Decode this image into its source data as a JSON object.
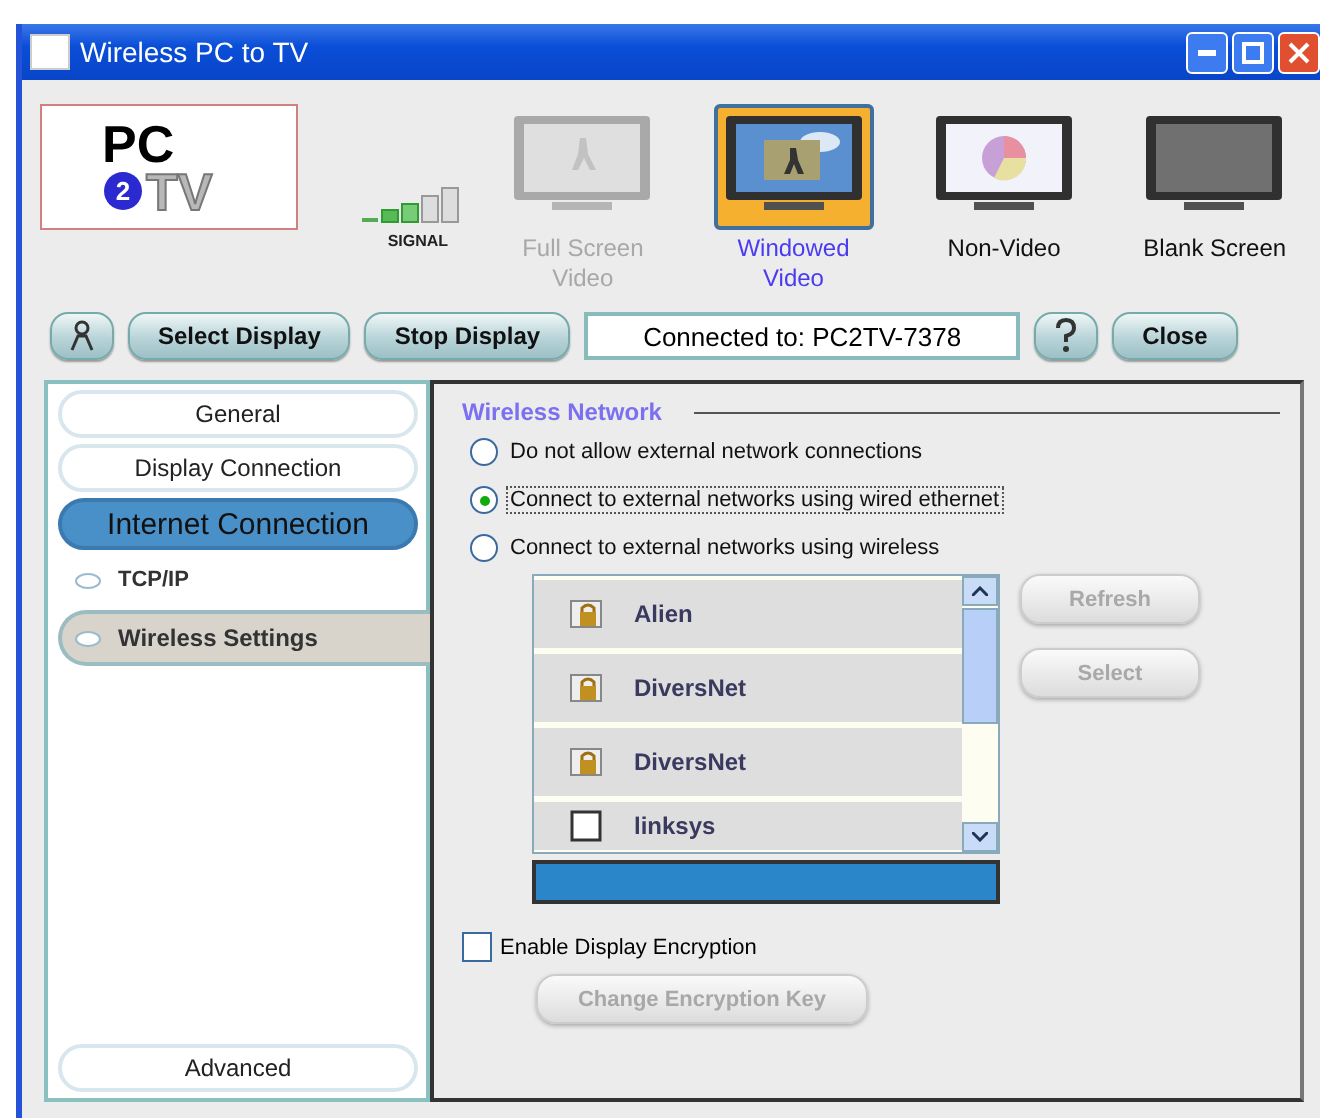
{
  "window": {
    "title": "Wireless PC to TV"
  },
  "logo": {
    "parts": [
      "PC",
      "2",
      "TV"
    ]
  },
  "signal": {
    "label": "SIGNAL"
  },
  "display_modes": [
    {
      "label": "Full Screen Video",
      "kind": "video",
      "selected": false,
      "disabled": true
    },
    {
      "label": "Windowed Video",
      "kind": "windowed",
      "selected": true,
      "disabled": false
    },
    {
      "label": "Non-Video",
      "kind": "chart",
      "selected": false,
      "disabled": false
    },
    {
      "label": "Blank Screen",
      "kind": "blank",
      "selected": false,
      "disabled": false
    }
  ],
  "toolbar": {
    "buttons": [
      {
        "kind": "icon"
      },
      {
        "kind": "text",
        "label": "Select Display"
      },
      {
        "kind": "text",
        "label": "Stop Display"
      },
      {
        "kind": "status",
        "label": "Connected to: PC2TV-7378"
      },
      {
        "kind": "icon"
      },
      {
        "kind": "text",
        "label": "Close"
      }
    ]
  },
  "sidebar": {
    "items": [
      {
        "label": "General",
        "selected": false
      },
      {
        "label": "Display Connection",
        "selected": false
      },
      {
        "label": "Internet Connection",
        "selected": true,
        "children": [
          {
            "label": "TCP/IP",
            "selected": false
          },
          {
            "label": "Wireless Settings",
            "selected": true
          }
        ]
      }
    ],
    "bottom_item": {
      "label": "Advanced",
      "selected": false
    }
  },
  "wireless_network": {
    "title": "Wireless Network",
    "options": [
      {
        "label": "Do not allow external network connections",
        "selected": false
      },
      {
        "label": "Connect to external networks using wired ethernet",
        "selected": true
      },
      {
        "label": "Connect to external networks using wireless",
        "selected": false
      }
    ],
    "networks": [
      {
        "name": "Alien",
        "locked": true
      },
      {
        "name": "DiversNet",
        "locked": true
      },
      {
        "name": "DiversNet",
        "locked": true
      },
      {
        "name": "linksys",
        "locked": false
      }
    ],
    "buttons": [
      {
        "label": "Refresh",
        "disabled": true
      },
      {
        "label": "Select",
        "disabled": true
      }
    ],
    "encryption": {
      "label": "Enable Display Encryption",
      "checked": false
    },
    "change_key": {
      "label": "Change Encryption Key",
      "disabled": true
    }
  }
}
